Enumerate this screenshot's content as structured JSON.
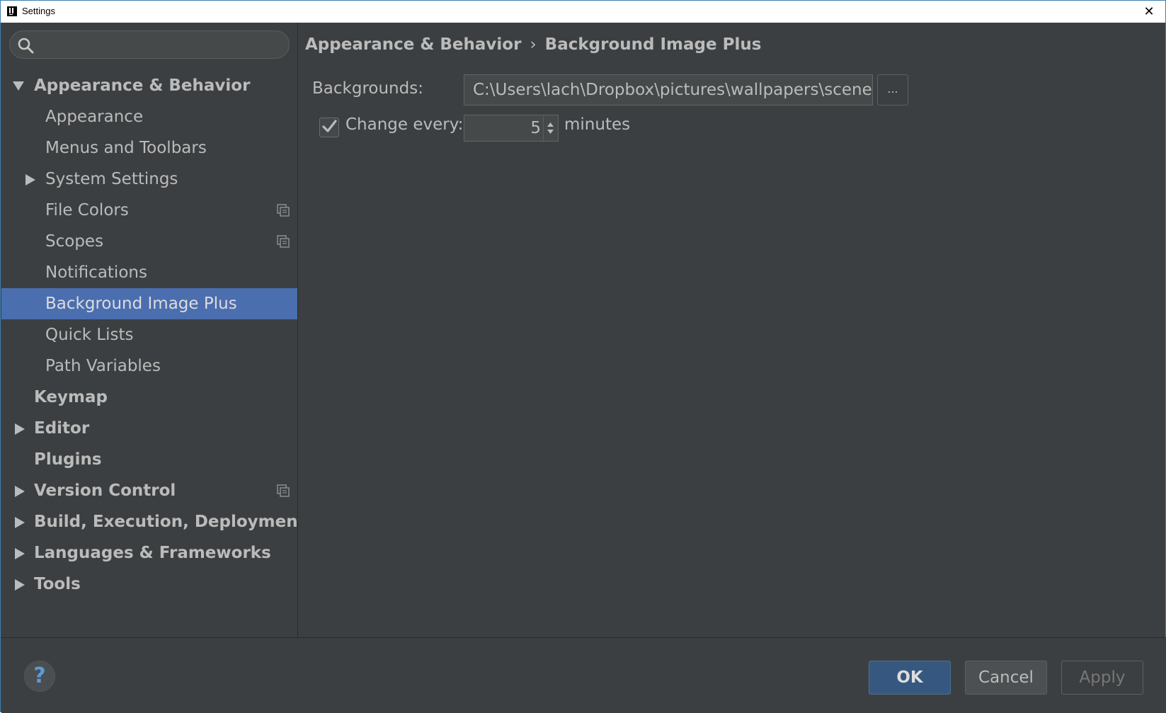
{
  "window": {
    "title": "Settings",
    "close_glyph": "✕"
  },
  "search": {
    "placeholder": "",
    "value": ""
  },
  "tree": {
    "items": [
      {
        "label": "Appearance & Behavior"
      },
      {
        "label": "Appearance"
      },
      {
        "label": "Menus and Toolbars"
      },
      {
        "label": "System Settings"
      },
      {
        "label": "File Colors"
      },
      {
        "label": "Scopes"
      },
      {
        "label": "Notifications"
      },
      {
        "label": "Background Image Plus"
      },
      {
        "label": "Quick Lists"
      },
      {
        "label": "Path Variables"
      },
      {
        "label": "Keymap"
      },
      {
        "label": "Editor"
      },
      {
        "label": "Plugins"
      },
      {
        "label": "Version Control"
      },
      {
        "label": "Build, Execution, Deployment"
      },
      {
        "label": "Languages & Frameworks"
      },
      {
        "label": "Tools"
      }
    ],
    "selected": "Background Image Plus"
  },
  "breadcrumb": {
    "parent": "Appearance & Behavior",
    "separator": "›",
    "current": "Background Image Plus"
  },
  "form": {
    "backgrounds_label": "Backgrounds:",
    "backgrounds_value": "C:\\Users\\lach\\Dropbox\\pictures\\wallpapers\\scenery",
    "browse_label": "...",
    "change_every_label": "Change every:",
    "change_every_checked": true,
    "change_every_value": "5",
    "minutes_label": "minutes"
  },
  "footer": {
    "help_label": "?",
    "ok_label": "OK",
    "cancel_label": "Cancel",
    "apply_label": "Apply"
  },
  "colors": {
    "background": "#3c3f41",
    "selection": "#4b6eaf",
    "text": "#bbbbbb",
    "ok_button": "#365880"
  }
}
